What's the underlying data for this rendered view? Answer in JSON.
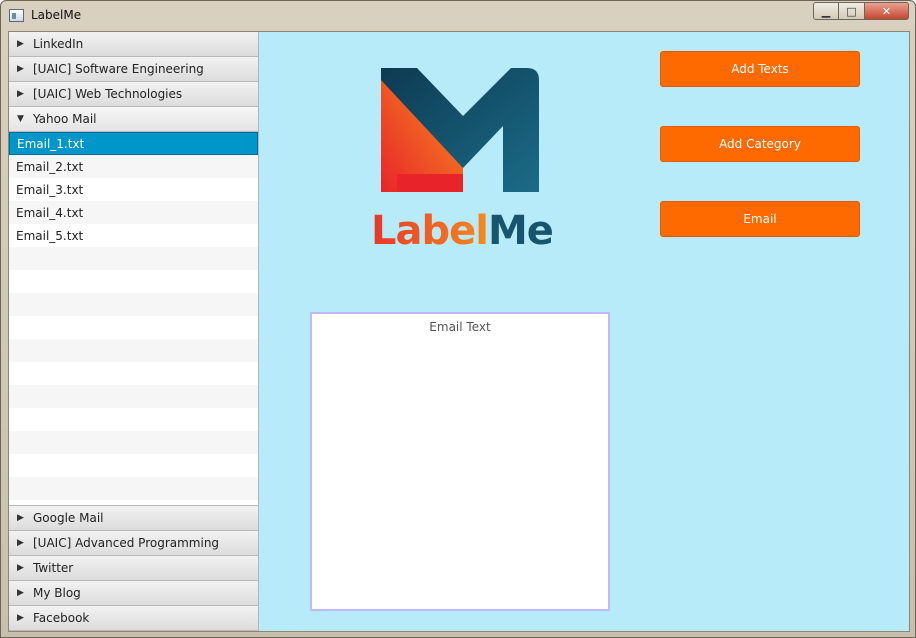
{
  "window": {
    "title": "LabelMe",
    "controls": {
      "minimize": "▁",
      "maximize": "□",
      "close": "✕"
    }
  },
  "sidebar": {
    "top_panes": [
      {
        "label": "LinkedIn",
        "expanded": false
      },
      {
        "label": "[UAIC] Software Engineering",
        "expanded": false
      },
      {
        "label": "[UAIC] Web Technologies",
        "expanded": false
      },
      {
        "label": "Yahoo Mail",
        "expanded": true
      }
    ],
    "files": [
      {
        "label": "Email_1.txt",
        "selected": true
      },
      {
        "label": "Email_2.txt",
        "selected": false
      },
      {
        "label": "Email_3.txt",
        "selected": false
      },
      {
        "label": "Email_4.txt",
        "selected": false
      },
      {
        "label": "Email_5.txt",
        "selected": false
      }
    ],
    "bottom_panes": [
      {
        "label": "Google Mail",
        "expanded": false
      },
      {
        "label": "[UAIC] Advanced Programming",
        "expanded": false
      },
      {
        "label": "Twitter",
        "expanded": false
      },
      {
        "label": "My Blog",
        "expanded": false
      },
      {
        "label": "Facebook",
        "expanded": false
      }
    ]
  },
  "logo": {
    "text_label": "Label",
    "text_me": "Me"
  },
  "actions": {
    "add_texts": "Add Texts",
    "add_category": "Add Category",
    "email": "Email"
  },
  "email_panel": {
    "title": "Email Text"
  },
  "colors": {
    "accent": "#ff6a00",
    "background": "#b8ebf9",
    "selection": "#0096c9",
    "logo_dark": "#17556f",
    "logo_warm": "#f78a1d"
  }
}
